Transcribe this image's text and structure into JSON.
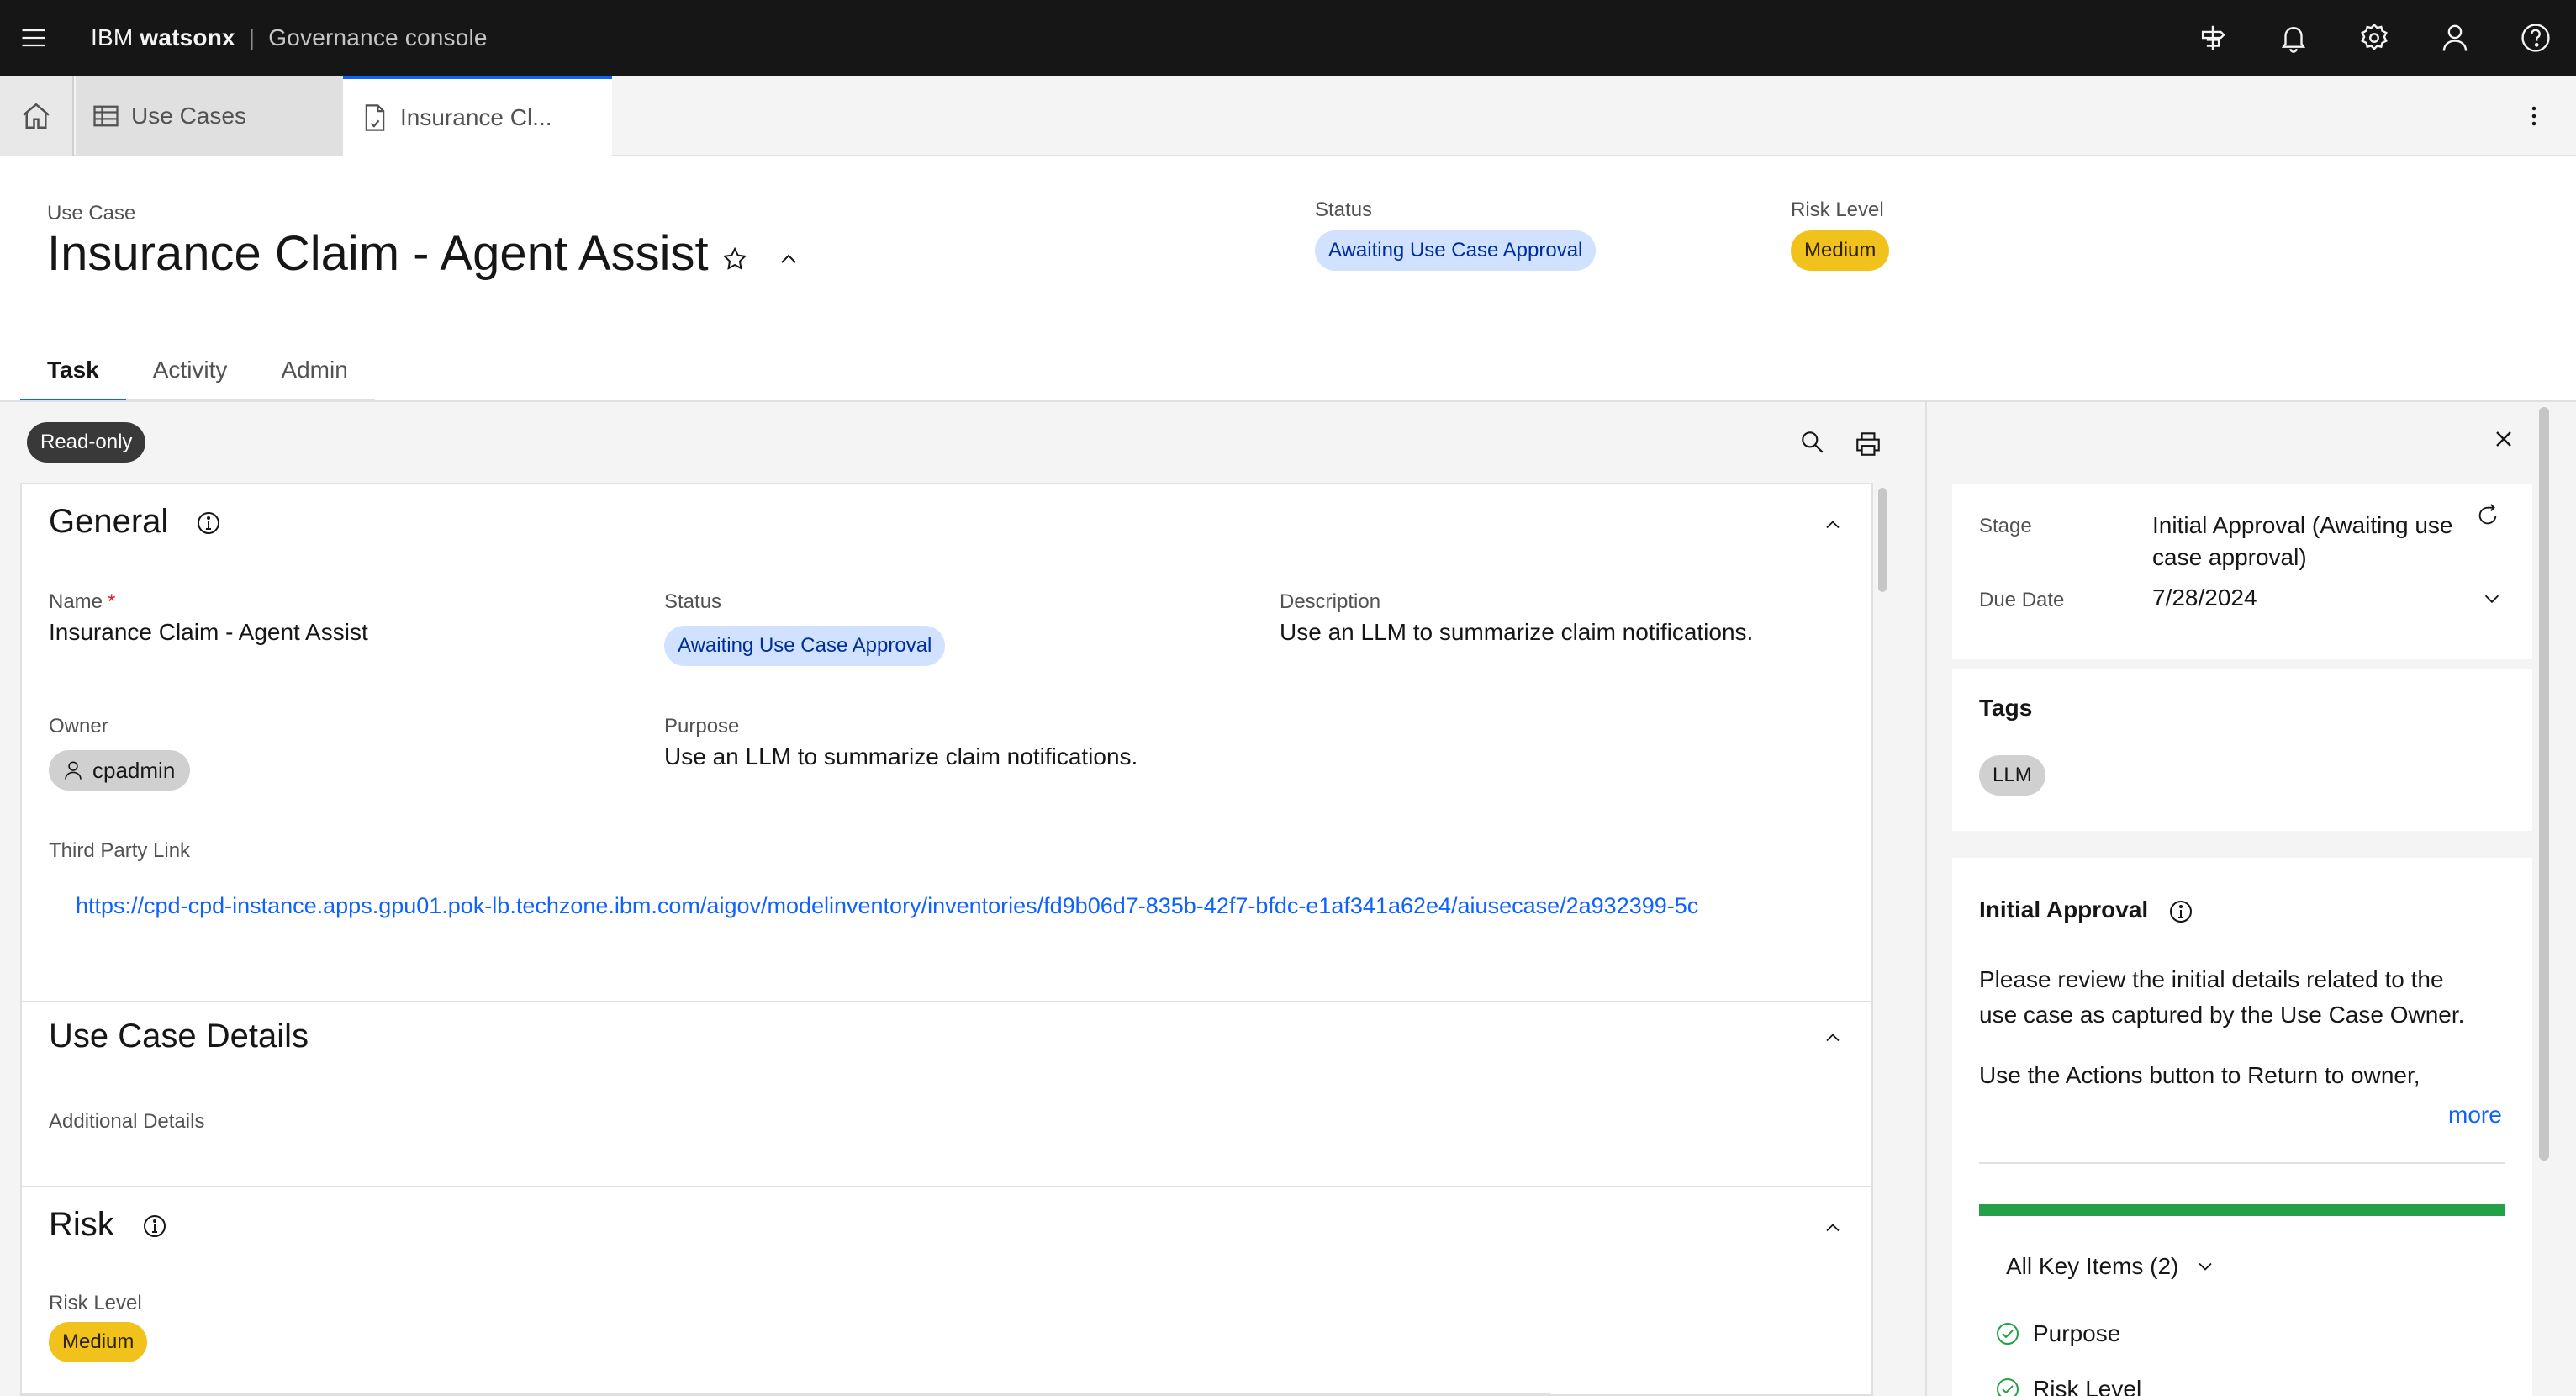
{
  "topbar": {
    "brand_ibm": "IBM",
    "brand_product": "watsonx",
    "brand_separator": "|",
    "brand_app": "Governance console",
    "icons": [
      "menu-icon",
      "launch-icon",
      "notification-icon",
      "settings-icon",
      "user-icon",
      "help-icon"
    ]
  },
  "workspace_tabs": [
    {
      "label": "Use Cases",
      "icon": "table-icon"
    },
    {
      "label": "Insurance Cl...",
      "icon": "document-icon",
      "active": true
    }
  ],
  "header": {
    "type_label": "Use Case",
    "title": "Insurance Claim - Agent Assist",
    "status_label": "Status",
    "status_value": "Awaiting Use Case Approval",
    "risk_label": "Risk Level",
    "risk_value": "Medium"
  },
  "tabs": [
    "Task",
    "Activity",
    "Admin"
  ],
  "active_tab": "Task",
  "toolbar": {
    "readonly": "Read-only"
  },
  "general": {
    "title": "General",
    "name_label": "Name",
    "name_required": "*",
    "name_value": "Insurance Claim - Agent Assist",
    "status_label": "Status",
    "status_value": "Awaiting Use Case Approval",
    "description_label": "Description",
    "description_value": "Use an LLM to summarize claim notifications.",
    "owner_label": "Owner",
    "owner_value": "cpadmin",
    "purpose_label": "Purpose",
    "purpose_value": "Use an LLM to summarize claim notifications.",
    "third_party_label": "Third Party Link",
    "third_party_value": "https://cpd-cpd-instance.apps.gpu01.pok-lb.techzone.ibm.com/aigov/modelinventory/inventories/fd9b06d7-835b-42f7-bfdc-e1af341a62e4/aiusecase/2a932399-5c"
  },
  "use_case_details": {
    "title": "Use Case Details",
    "additional_label": "Additional Details"
  },
  "risk": {
    "title": "Risk",
    "risk_level_label": "Risk Level",
    "risk_level_value": "Medium"
  },
  "side": {
    "stage_label": "Stage",
    "stage_value_line1": "Initial Approval (Awaiting use",
    "stage_value_line2": "case approval)",
    "due_label": "Due Date",
    "due_value": "7/28/2024",
    "tags_title": "Tags",
    "tag": "LLM",
    "approval_title": "Initial Approval",
    "approval_text_line1": "Please review the initial details related to the",
    "approval_text_line2": "use case as captured by the Use Case Owner.",
    "approval_text_line3": "Use the Actions button to Return to owner,",
    "more": "more",
    "progress_fraction": 1.0,
    "key_items": "All Key Items (2)",
    "items": [
      "Purpose",
      "Risk Level"
    ]
  },
  "colors": {
    "topbar": "#161616",
    "accent": "#0f62fe",
    "status_tag_bg": "#d0e2ff",
    "risk_tag_bg": "#f1c21b",
    "progress": "#24a148"
  }
}
